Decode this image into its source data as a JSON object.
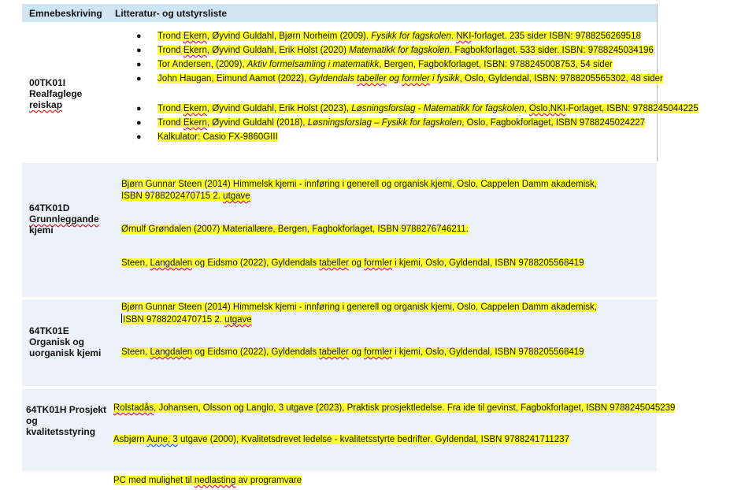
{
  "header": {
    "col1": "Emnebeskriving",
    "col2": "Litteratur- og utstyrsliste"
  },
  "rows": [
    {
      "code_l1": "00TK01I",
      "code_l2": "Realfaglege",
      "code_l3": "reiskap",
      "items": [
        {
          "a": "Trond ",
          "b": "Ekern",
          "c": ", Øyvind Guldahl, Bjørn Norheim (2009). ",
          "d": "Fysikk for fagskolen",
          "e": ". ",
          "f": "NKI",
          "g": "-forlaget. 235 sider ISBN: 9788256269518"
        },
        {
          "a": "Trond ",
          "b": "Ekern",
          "c": ", Øyvind Guldahl, Erik Holst (2020) ",
          "d": "Matematikk for fagskolen",
          "e": ". Fagbokforlaget. 533 sider. ISBN: 9788245034196"
        },
        {
          "a": "Tor Andersen, (2009), ",
          "b": "Aktiv formelsamling i matematikk",
          "c": ", Bergen, Fagbokforlaget, ISBN: 9788245008753, 54 sider"
        },
        {
          "a": "John Haugan, Eimund Aamot (2022), ",
          "b": "Gyldendals ",
          "c": "tabeller",
          "d": " og ",
          "e": "formler",
          "f": " i fysikk",
          "g": ", Oslo, Gyldendal, ISBN: 9788205565302, 48 sider"
        },
        {
          "a": "Trond ",
          "b": "Ekern",
          "c": ", Øyvind Guldahl, Erik Holst (2023), ",
          "d": "Løsningsforslag - Matematikk for fagskolen",
          "e": ", ",
          "f": "Oslo,NKI",
          "g": "-Forlaget, ISBN: 9788245044225"
        },
        {
          "a": "Trond ",
          "b": "Ekern",
          "c": ", Øyvind Guldahl (2018), ",
          "d": "Løsningsforslag – Fysikk for fagskolen",
          "e": ", Oslo, Fagbokforlaget, ISBN 9788245024227"
        },
        {
          "a": "Kalkulator: Casio FX-9860GIII"
        }
      ]
    },
    {
      "code_l1": "64TK01D",
      "code_l2": "Grunnleggande",
      "code_l3": "kjemi",
      "items": [
        {
          "a": "Bjørn Gunnar Steen (2014) Himmelsk kjemi - innføring i generell og organisk kjemi, Oslo, Cappelen Damm akademisk,",
          "b": "ISBN 9788202470715 2. ",
          "c": "utgave"
        },
        {
          "a": "Ørnulf Grøndalen (2007) Materiallære, Bergen, Fagbokforlaget, ISBN 9788276746211."
        },
        {
          "a": "Steen, ",
          "b": "Langdalen",
          "c": " og Eidsmo (2022), Gyldendals ",
          "d": "tabeller",
          "e": " og ",
          "f": "formler",
          "g": " i kjemi, Oslo, Gyldendal, ISBN 9788205568419"
        }
      ]
    },
    {
      "code_l1": "64TK01E",
      "code_l2": "Organisk og",
      "code_l3": "uorganisk kjemi",
      "items": [
        {
          "a": "Bjørn Gunnar Steen (2014) Himmelsk kjemi - innføring i generell og organisk kjemi, Oslo, Cappelen Damm akademisk,",
          "b": "ISBN 9788202470715 2. ",
          "c": "utgave"
        },
        {
          "a": "Steen, ",
          "b": "Langdalen",
          "c": " og Eidsmo (2022), Gyldendals ",
          "d": "tabeller",
          "e": " og ",
          "f": "formler",
          "g": " i kjemi, Oslo, Gyldendal, ISBN 9788205568419"
        }
      ]
    },
    {
      "code_l1": "64TK01H Prosjekt",
      "code_l2": "og",
      "code_l3": "kvalitetsstyring",
      "items": [
        {
          "a": "Rolstadås",
          "b": ", Johansen, Olsson og Langlo, 3 utgave (2023), Praktisk prosjektledelse. Fra ide til gevinst, Fagbokforlaget, ISBN 9788245045239"
        },
        {
          "a": "Asbjørn ",
          "b": "Aune,  3",
          "c": " utgave (2000), Kvalitetsdrevet ledelse - kvalitetsstyrte bedrifter. Gyldendal, ISBN 9788241711237"
        }
      ]
    }
  ],
  "footer": {
    "a": "PC med mulighet til ",
    "b": "nedlasting",
    "c": " av programvare"
  }
}
